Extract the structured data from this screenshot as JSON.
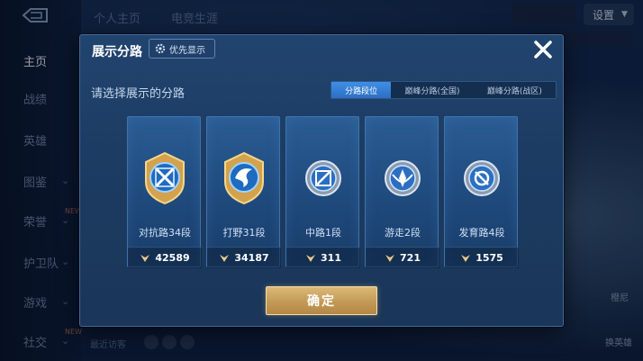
{
  "background": {
    "top_tabs": [
      "个人主页",
      "电竞生涯"
    ],
    "settings_label": "设置",
    "sidebar_items": [
      {
        "label": "主页",
        "active": true,
        "chevron": false,
        "new_badge": false
      },
      {
        "label": "战绩",
        "active": false,
        "chevron": false,
        "new_badge": false
      },
      {
        "label": "英雄",
        "active": false,
        "chevron": false,
        "new_badge": false
      },
      {
        "label": "图鉴",
        "active": false,
        "chevron": true,
        "new_badge": false
      },
      {
        "label": "荣誉",
        "active": false,
        "chevron": true,
        "new_badge": true
      },
      {
        "label": "护卫队",
        "active": false,
        "chevron": true,
        "new_badge": false
      },
      {
        "label": "游戏",
        "active": false,
        "chevron": true,
        "new_badge": false
      },
      {
        "label": "社交",
        "active": false,
        "chevron": true,
        "new_badge": true
      }
    ],
    "new_badge_text": "NEW",
    "recent_visitors": "最近访客",
    "right_labels": [
      "橙尼",
      "换英雄"
    ]
  },
  "dialog": {
    "title": "展示分路",
    "priority_button": "优先显示",
    "prompt": "请选择展示的分路",
    "tabs": [
      {
        "label": "分路段位",
        "active": true
      },
      {
        "label": "巅峰分路(全国)",
        "active": false
      },
      {
        "label": "巅峰分路(战区)",
        "active": false
      }
    ],
    "lanes": [
      {
        "label": "对抗路34段",
        "value": "42589",
        "emblem": "clash-lane-emblem-icon"
      },
      {
        "label": "打野31段",
        "value": "34187",
        "emblem": "jungle-emblem-icon"
      },
      {
        "label": "中路1段",
        "value": "311",
        "emblem": "mid-lane-emblem-icon"
      },
      {
        "label": "游走2段",
        "value": "721",
        "emblem": "roam-emblem-icon"
      },
      {
        "label": "发育路4段",
        "value": "1575",
        "emblem": "farm-lane-emblem-icon"
      }
    ],
    "confirm_button": "确定"
  },
  "colors": {
    "accent_blue": "#3f8fe6",
    "gold": "#c39a55",
    "panel": "#1d3c63"
  }
}
